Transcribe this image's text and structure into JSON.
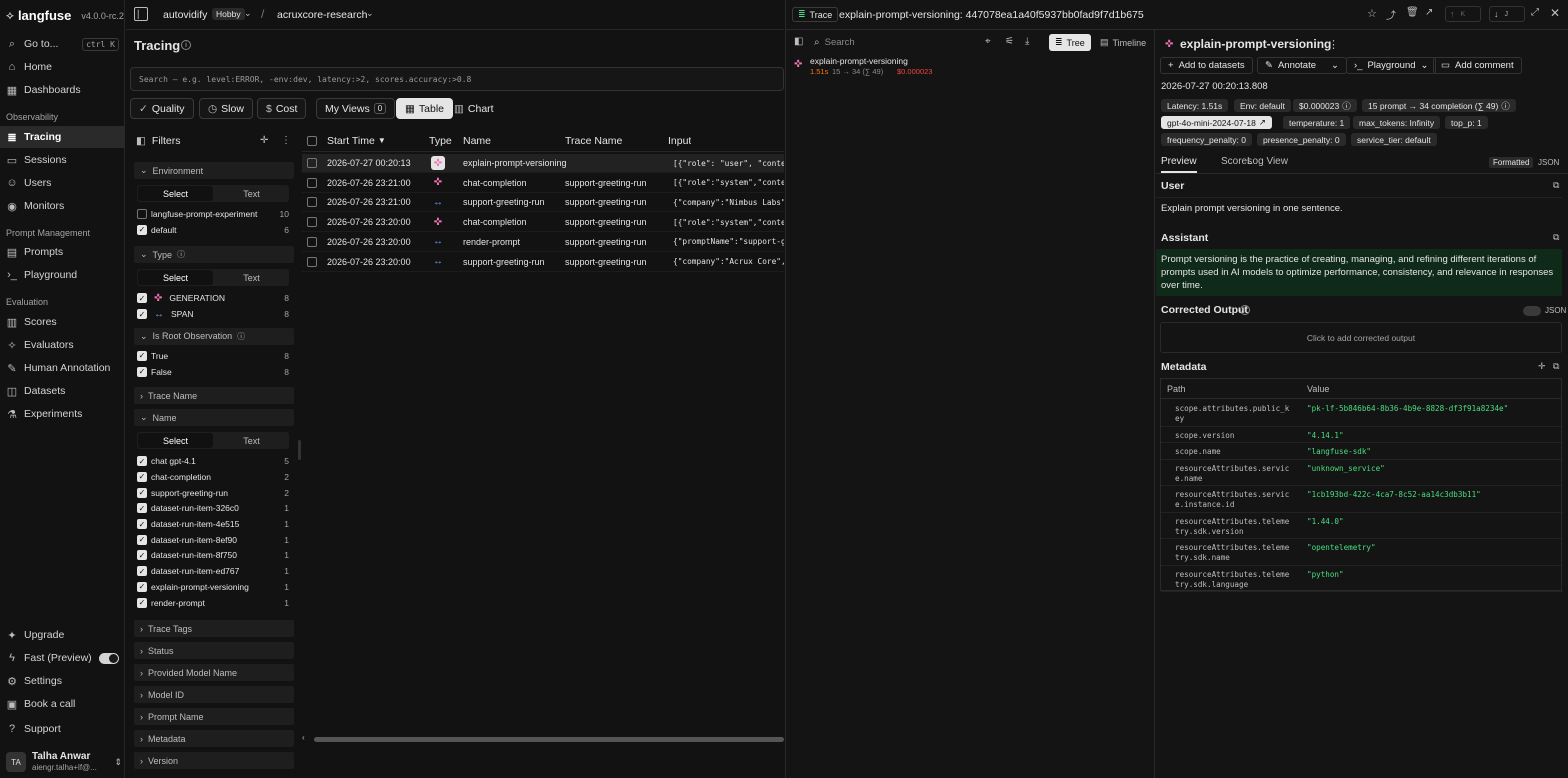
{
  "brand": {
    "name": "langfuse",
    "version": "v4.0.0-rc.2"
  },
  "sidebar": {
    "goto": "Go to...",
    "goto_kbd": "ctrl K",
    "home": "Home",
    "dashboards": "Dashboards",
    "sec_observability": "Observability",
    "tracing": "Tracing",
    "sessions": "Sessions",
    "users": "Users",
    "monitors": "Monitors",
    "sec_prompt": "Prompt Management",
    "prompts": "Prompts",
    "playground": "Playground",
    "sec_eval": "Evaluation",
    "scores": "Scores",
    "evaluators": "Evaluators",
    "human_annotation": "Human Annotation",
    "datasets": "Datasets",
    "experiments": "Experiments",
    "upgrade": "Upgrade",
    "fast_preview": "Fast (Preview)",
    "settings": "Settings",
    "book_call": "Book a call",
    "support": "Support",
    "user_initials": "TA",
    "user_name": "Talha Anwar",
    "user_email": "aiengr.talha+lf@..."
  },
  "topbar": {
    "org": "autovidify",
    "plan": "Hobby",
    "project": "acruxcore-research"
  },
  "page": {
    "title": "Tracing",
    "search_placeholder": "Search — e.g. level:ERROR, -env:dev, latency:>2, scores.accuracy:>0.8",
    "presets": {
      "quality": "Quality",
      "slow": "Slow",
      "cost": "Cost",
      "my_views": "My Views",
      "my_views_count": "0"
    },
    "view_table": "Table",
    "view_chart": "Chart"
  },
  "filters": {
    "title": "Filters",
    "select": "Select",
    "text": "Text",
    "environment": {
      "label": "Environment",
      "items": [
        {
          "label": "langfuse-prompt-experiment",
          "count": "10",
          "checked": false
        },
        {
          "label": "default",
          "count": "6",
          "checked": true
        }
      ]
    },
    "type": {
      "label": "Type",
      "items": [
        {
          "label": "GENERATION",
          "count": "8"
        },
        {
          "label": "SPAN",
          "count": "8"
        }
      ]
    },
    "is_root": {
      "label": "Is Root Observation",
      "items": [
        {
          "label": "True",
          "count": "8"
        },
        {
          "label": "False",
          "count": "8"
        }
      ]
    },
    "trace_name": "Trace Name",
    "name": {
      "label": "Name",
      "items": [
        {
          "label": "chat gpt-4.1",
          "count": "5"
        },
        {
          "label": "chat-completion",
          "count": "2"
        },
        {
          "label": "support-greeting-run",
          "count": "2"
        },
        {
          "label": "dataset-run-item-326c0",
          "count": "1"
        },
        {
          "label": "dataset-run-item-4e515",
          "count": "1"
        },
        {
          "label": "dataset-run-item-8ef90",
          "count": "1"
        },
        {
          "label": "dataset-run-item-8f750",
          "count": "1"
        },
        {
          "label": "dataset-run-item-ed767",
          "count": "1"
        },
        {
          "label": "explain-prompt-versioning",
          "count": "1"
        },
        {
          "label": "render-prompt",
          "count": "1"
        }
      ]
    },
    "collapsed": [
      "Trace Tags",
      "Status",
      "Provided Model Name",
      "Model ID",
      "Prompt Name",
      "Metadata",
      "Version"
    ]
  },
  "table": {
    "headers": {
      "start_time": "Start Time",
      "type": "Type",
      "name": "Name",
      "trace_name": "Trace Name",
      "input": "Input"
    },
    "rows": [
      {
        "start": "2026-07-27 00:20:13",
        "type": "gen",
        "name": "explain-prompt-versioning",
        "trace": "",
        "input": "[{\"role\": \"user\", \"content\": \"Exp"
      },
      {
        "start": "2026-07-26 23:21:00",
        "type": "gen",
        "name": "chat-completion",
        "trace": "support-greeting-run",
        "input": "[{\"role\":\"system\",\"content\":\"Yo"
      },
      {
        "start": "2026-07-26 23:21:00",
        "type": "span",
        "name": "support-greeting-run",
        "trace": "support-greeting-run",
        "input": "{\"company\":\"Nimbus Labs\",\"na"
      },
      {
        "start": "2026-07-26 23:20:00",
        "type": "gen",
        "name": "chat-completion",
        "trace": "support-greeting-run",
        "input": "[{\"role\":\"system\",\"content\":\"Yo"
      },
      {
        "start": "2026-07-26 23:20:00",
        "type": "span",
        "name": "render-prompt",
        "trace": "support-greeting-run",
        "input": "{\"promptName\":\"support-gree"
      },
      {
        "start": "2026-07-26 23:20:00",
        "type": "span",
        "name": "support-greeting-run",
        "trace": "support-greeting-run",
        "input": "{\"company\":\"Acrux Core\",\"nam"
      }
    ]
  },
  "trace": {
    "tag": "Trace",
    "title": "explain-prompt-versioning: 447078ea1a40f5937bb0fad9f7d1b675",
    "nav_up_key": "K",
    "nav_down_key": "J",
    "search_placeholder": "Search",
    "tab_tree": "Tree",
    "tab_timeline": "Timeline",
    "tree_node": {
      "name": "explain-prompt-versioning",
      "latency": "1.51s",
      "tokens": "15 → 34 (∑ 49)",
      "cost": "$0.000023"
    },
    "obs_name": "explain-prompt-versioning",
    "actions": {
      "add_datasets": "Add to datasets",
      "annotate": "Annotate",
      "playground": "Playground",
      "add_comment": "Add comment"
    },
    "timestamp": "2026-07-27 00:20:13.808",
    "badges": {
      "latency": "Latency: 1.51s",
      "env": "Env: default",
      "cost": "$0.000023",
      "tokens": "15 prompt → 34 completion (∑ 49)",
      "model": "gpt-4o-mini-2024-07-18",
      "temperature": "temperature: 1",
      "max_tokens": "max_tokens: Infinity",
      "top_p": "top_p: 1",
      "freq": "frequency_penalty: 0",
      "presence": "presence_penalty: 0",
      "tier": "service_tier: default"
    },
    "tabs": {
      "preview": "Preview",
      "scores": "Scores",
      "log": "Log View",
      "formatted": "Formatted",
      "json": "JSON"
    },
    "user_label": "User",
    "user_text": "Explain prompt versioning in one sentence.",
    "assistant_label": "Assistant",
    "assistant_text": "Prompt versioning is the practice of creating, managing, and refining different iterations of prompts used in AI models to optimize performance, consistency, and relevance in responses over time.",
    "corrected_label": "Corrected Output",
    "corrected_json": "JSON",
    "corrected_placeholder": "Click to add corrected output",
    "metadata_label": "Metadata",
    "meta_path": "Path",
    "meta_value": "Value",
    "metadata": [
      {
        "path": "scope.attributes.public_k ey",
        "value": "\"pk-lf-5b846b64-8b36-4b9e-8828-df3f91a8234e\""
      },
      {
        "path": "scope.version",
        "value": "\"4.14.1\""
      },
      {
        "path": "scope.name",
        "value": "\"langfuse-sdk\""
      },
      {
        "path": "resourceAttributes.servic e.name",
        "value": "\"unknown_service\""
      },
      {
        "path": "resourceAttributes.servic e.instance.id",
        "value": "\"1cb193bd-422c-4ca7-8c52-aa14c3db3b11\""
      },
      {
        "path": "resourceAttributes.teleme try.sdk.version",
        "value": "\"1.44.0\""
      },
      {
        "path": "resourceAttributes.teleme try.sdk.name",
        "value": "\"opentelemetry\""
      },
      {
        "path": "resourceAttributes.teleme try.sdk.language",
        "value": "\"python\""
      }
    ]
  },
  "colors": {
    "accent_gen": "#f472b6",
    "accent_span": "#60a5fa",
    "value_green": "#4ade80",
    "cost_red": "#ef4444"
  }
}
